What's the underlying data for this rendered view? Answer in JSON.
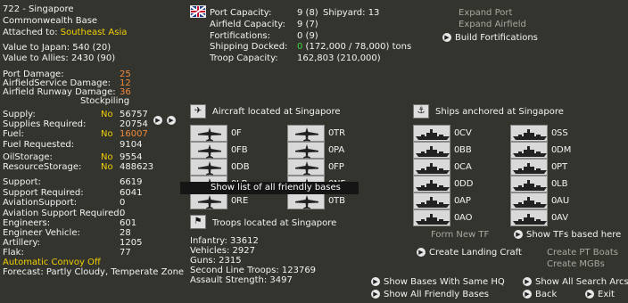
{
  "base": {
    "title": "722 - Singapore",
    "type": "Commonwealth Base",
    "attached_prefix": "Attached to: ",
    "attached_value": "Southeast Asia",
    "value_japan": "Value to Japan: 540 (20)",
    "value_allies": "Value to Allies: 2430 (90)"
  },
  "damage": {
    "port_label": "Port Damage:",
    "port_value": "25",
    "afs_label": "AirfieldService Damage:",
    "afs_value": "12",
    "afr_label": "Airfield Runway Damage:",
    "afr_value": "36",
    "stockpiling": "Stockpiling"
  },
  "supply": {
    "supply_label": "Supply:",
    "supply_flag": "No",
    "supply_value": "56757",
    "supreq_label": "Supplies Required:",
    "supreq_value": "20754",
    "fuel_label": "Fuel:",
    "fuel_flag": "No",
    "fuel_value": "16007",
    "fuelreq_label": "Fuel Requested:",
    "fuelreq_value": "9104",
    "oil_label": "OilStorage:",
    "oil_flag": "No",
    "oil_value": "9554",
    "res_label": "ResourceStorage:",
    "res_flag": "No",
    "res_value": "488623"
  },
  "support": {
    "support_label": "Support:",
    "support_value": "6619",
    "supreq_label": "Support Required:",
    "supreq_value": "6041",
    "av_label": "AviationSupport:",
    "av_value": "0",
    "avreq_label": "Aviation Support Required:",
    "avreq_value": "0",
    "eng_label": "Engineers:",
    "eng_value": "601",
    "engveh_label": "Engineer Vehicle:",
    "engveh_value": "28",
    "art_label": "Artillery:",
    "art_value": "1205",
    "flak_label": "Flak:",
    "flak_value": "77",
    "convoy": "Automatic Convoy Off",
    "forecast": "Forecast: Partly Cloudy, Temperate Zone"
  },
  "port": {
    "capacity_label": "Port Capacity:",
    "capacity_value": "9 (8)",
    "shipyard_label": "Shipyard: 13",
    "airfield_label": "Airfield Capacity:",
    "airfield_value": "9 (7)",
    "fort_label": "Fortifications:",
    "fort_value": "0 (9)",
    "ship_label": "Shipping Docked:",
    "ship_value_green": "0",
    "ship_value_rest": " (172,000 / 78,000) tons",
    "troop_label": "Troop Capacity:",
    "troop_value": "162,803  (210,000)",
    "expand_port": "Expand Port",
    "expand_airfield": "Expand Airfield",
    "build_fort": "Build Fortifications"
  },
  "aircraft": {
    "header": "Aircraft located at Singapore",
    "left": [
      {
        "count": "0",
        "code": "F"
      },
      {
        "count": "0",
        "code": "FB"
      },
      {
        "count": "0",
        "code": "DB"
      },
      {
        "count": "0",
        "code": "LB"
      },
      {
        "count": "0",
        "code": "RE"
      }
    ],
    "right": [
      {
        "count": "0",
        "code": "TR"
      },
      {
        "count": "0",
        "code": "PA"
      },
      {
        "count": "0",
        "code": "FP"
      },
      {
        "count": "0",
        "code": "NF"
      },
      {
        "count": "0",
        "code": "TB"
      }
    ]
  },
  "tooltip": "Show list of all friendly bases",
  "troops": {
    "header": "Troops located at Singapore",
    "infantry": "Infantry: 33612",
    "vehicles": "Vehicles: 2927",
    "guns": "Guns: 2315",
    "second_line": "Second Line Troops: 123769",
    "assault": "Assault Strength: 3497"
  },
  "ships": {
    "header": "Ships anchored at Singapore",
    "left": [
      {
        "count": "0",
        "code": "CV"
      },
      {
        "count": "0",
        "code": "BB"
      },
      {
        "count": "0",
        "code": "CA"
      },
      {
        "count": "0",
        "code": "DD"
      },
      {
        "count": "0",
        "code": "AP"
      },
      {
        "count": "0",
        "code": "AO"
      }
    ],
    "right": [
      {
        "count": "0",
        "code": "SS"
      },
      {
        "count": "0",
        "code": "DM"
      },
      {
        "count": "0",
        "code": "PT"
      },
      {
        "count": "0",
        "code": "LB"
      },
      {
        "count": "0",
        "code": "AU"
      },
      {
        "count": "0",
        "code": "AV"
      }
    ],
    "form_tf": "Form New TF",
    "show_tfs": "Show TFs based here",
    "create_landing": "Create Landing Craft",
    "create_pt": "Create PT Boats",
    "create_mgb": "Create MGBs"
  },
  "footer": {
    "same_hq": "Show Bases With Same HQ",
    "all_friendly": "Show All Friendly Bases",
    "search_arcs": "Show All Search Arcs",
    "back": "Back",
    "exit": "Exit"
  }
}
